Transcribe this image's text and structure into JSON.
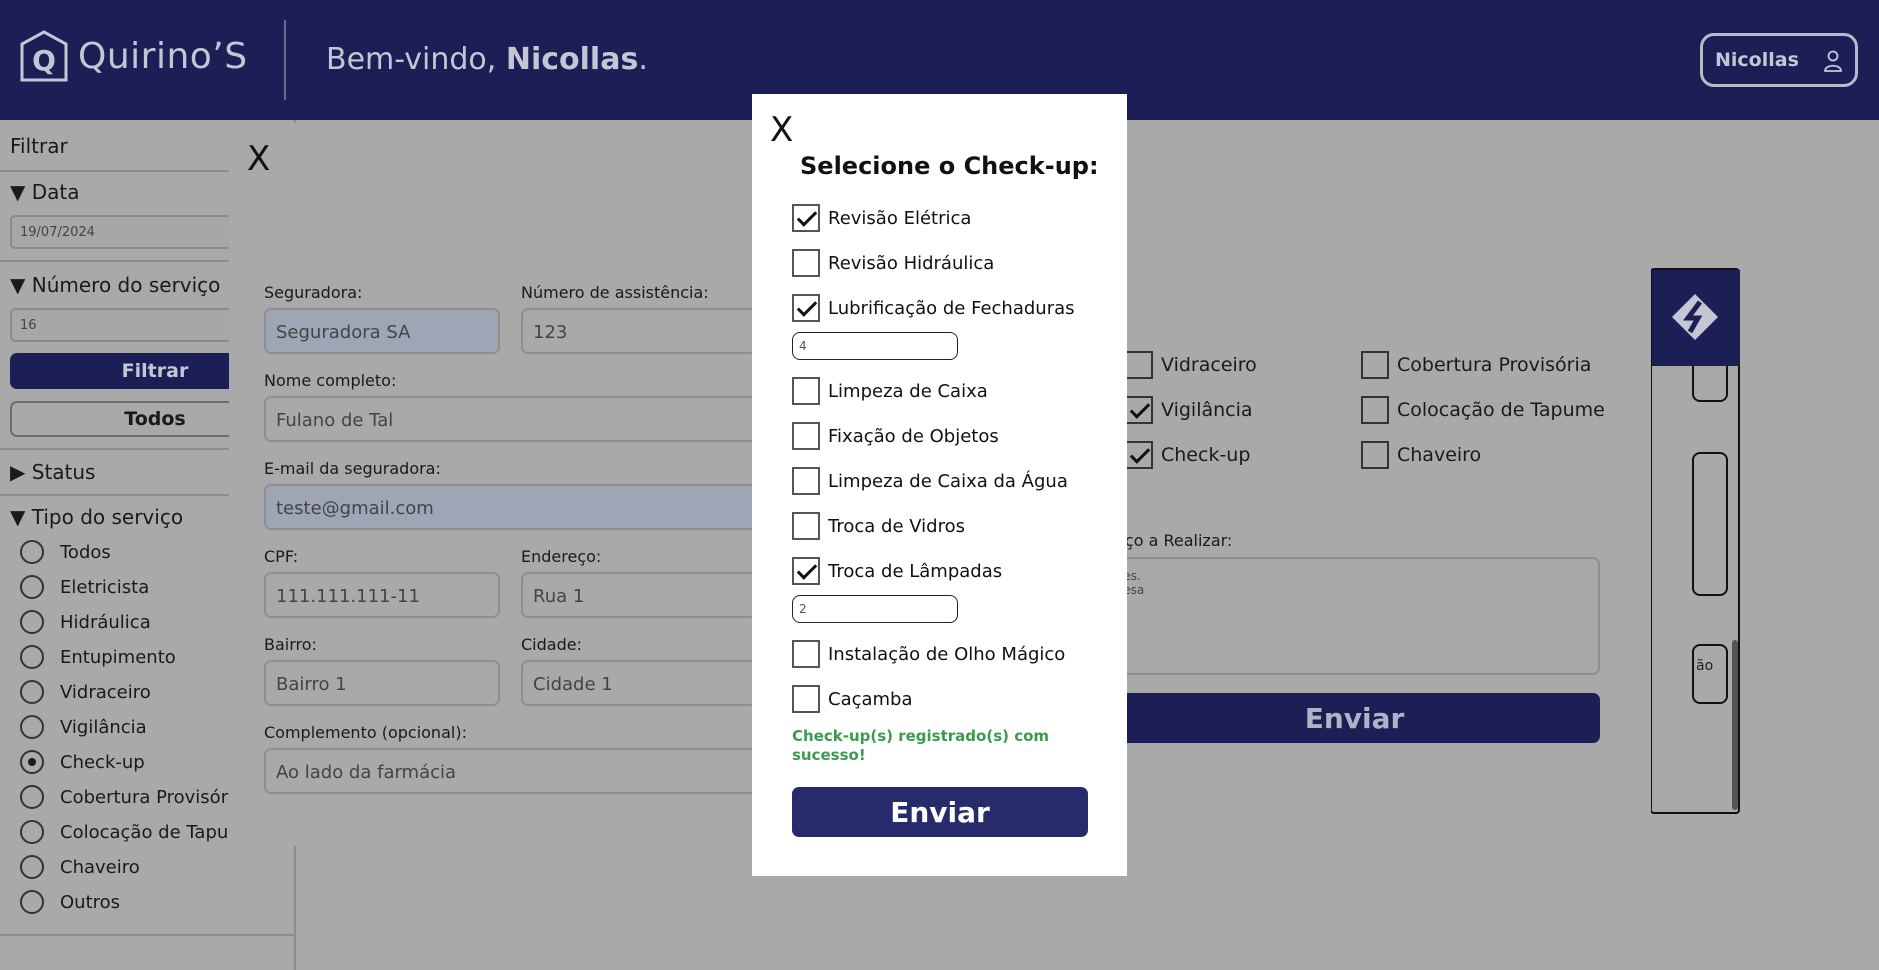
{
  "header": {
    "logo_text": "Quirino’S",
    "welcome_prefix": "Bem-vindo, ",
    "welcome_name": "Nicollas",
    "welcome_suffix": ".",
    "user_button": "Nicollas",
    "brand_color": "#1c1f55"
  },
  "sidebar": {
    "title": "Filtrar",
    "data_section": "Data",
    "data_value": "19/07/2024",
    "numero_section": "Número do serviço",
    "numero_value": "16",
    "filtrar_button": "Filtrar",
    "todos_button": "Todos",
    "status_section": "Status",
    "tipo_section": "Tipo do serviço",
    "tipos": [
      "Todos",
      "Eletricista",
      "Hidráulica",
      "Entupimento",
      "Vidraceiro",
      "Vigilância",
      "Check-up",
      "Cobertura Provisória",
      "Colocação de Tapume",
      "Chaveiro",
      "Outros"
    ],
    "tipo_selected": "Check-up"
  },
  "form": {
    "close": "X",
    "seguradora_label": "Seguradora:",
    "seguradora_value": "Seguradora SA",
    "assistencia_label": "Número de assistência:",
    "assistencia_value": "123",
    "nome_label": "Nome completo:",
    "nome_value": "Fulano de Tal",
    "email_label": "E-mail da seguradora:",
    "email_value": "teste@gmail.com",
    "cpf_label": "CPF:",
    "cpf_value": "111.111.111-11",
    "endereco_label": "Endereço:",
    "endereco_value": "Rua 1",
    "bairro_label": "Bairro:",
    "bairro_value": "Bairro 1",
    "cidade_label": "Cidade:",
    "cidade_value": "Cidade 1",
    "complemento_label": "Complemento (opcional):",
    "complemento_value": "Ao lado da farmácia",
    "services": [
      {
        "label": "Vidraceiro",
        "checked": false
      },
      {
        "label": "Cobertura Provisória",
        "checked": false
      },
      {
        "label": "Vigilância",
        "checked": true
      },
      {
        "label": "Colocação de Tapume",
        "checked": false
      },
      {
        "label": "Check-up",
        "checked": true
      },
      {
        "label": "Chaveiro",
        "checked": false
      }
    ],
    "servico_label": "viço a Realizar:",
    "textarea_line1": "ntes.",
    "textarea_line2": "presa",
    "submit": "Enviar"
  },
  "checkup": {
    "close": "X",
    "title": "Selecione o Check-up:",
    "items": [
      {
        "label": "Revisão Elétrica",
        "checked": true
      },
      {
        "label": "Revisão Hidráulica",
        "checked": false
      },
      {
        "label": "Lubrificação de Fechaduras",
        "checked": true,
        "qty": "4"
      },
      {
        "label": "Limpeza de Caixa",
        "checked": false
      },
      {
        "label": "Fixação de Objetos",
        "checked": false
      },
      {
        "label": "Limpeza de Caixa da Água",
        "checked": false
      },
      {
        "label": "Troca de Vidros",
        "checked": false
      },
      {
        "label": "Troca de Lâmpadas",
        "checked": true,
        "qty": "2"
      },
      {
        "label": "Instalação de Olho Mágico",
        "checked": false
      },
      {
        "label": "Caçamba",
        "checked": false
      }
    ],
    "success_message": "Check-up(s) registrado(s) com sucesso!",
    "submit": "Enviar",
    "success_color": "#3c9a4e"
  },
  "background_card": {
    "partial_text": "ão"
  }
}
